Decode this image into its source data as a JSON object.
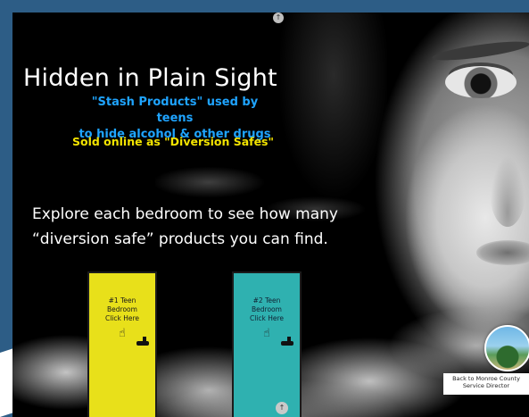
{
  "slide": {
    "title": "Hidden in Plain Sight",
    "subtitle_line1": "\"Stash Products\" used by teens",
    "subtitle_line2": "to hide alcohol & other drugs",
    "sold_line": "Sold online as \"Diversion Safes\"",
    "explore_line1": "Explore each bedroom to see how many",
    "explore_line2": "“diversion safe” products you can find."
  },
  "doors": [
    {
      "label": "#1 Teen\nBedroom\nClick Here",
      "color": "#e8e01a",
      "icon": "pointing-hand-icon"
    },
    {
      "label": "#2 Teen\nBedroom\nClick Here",
      "color": "#2fb1b0",
      "icon": "pointing-hand-icon"
    }
  ],
  "badge": {
    "caption": "Back to Monroe County\nService Director"
  },
  "nav": {
    "up_glyph": "↑"
  },
  "colors": {
    "frame": "#2d5d86",
    "title": "#ffffff",
    "subtitle": "#1fa4ff",
    "sold": "#f3e400"
  }
}
